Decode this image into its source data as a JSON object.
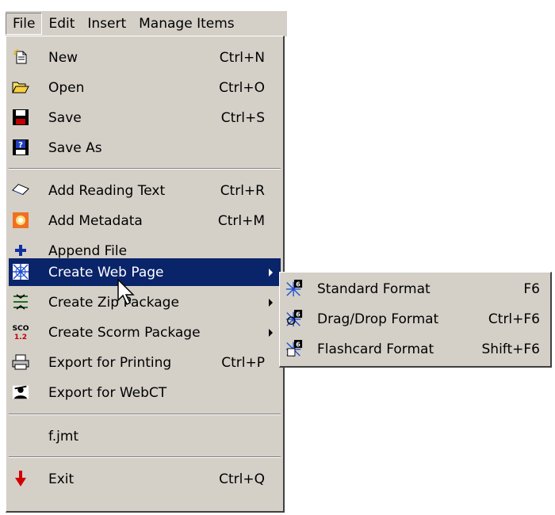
{
  "menubar": {
    "file": "File",
    "edit": "Edit",
    "insert": "Insert",
    "manage_items": "Manage Items"
  },
  "file_menu": {
    "new": {
      "label": "New",
      "shortcut": "Ctrl+N",
      "icon": "new-document-icon"
    },
    "open": {
      "label": "Open",
      "shortcut": "Ctrl+O",
      "icon": "folder-open-icon"
    },
    "save": {
      "label": "Save",
      "shortcut": "Ctrl+S",
      "icon": "floppy-disk-icon"
    },
    "save_as": {
      "label": "Save As",
      "icon": "save-as-icon"
    },
    "add_reading_text": {
      "label": "Add Reading Text",
      "shortcut": "Ctrl+R",
      "icon": "book-icon"
    },
    "add_metadata": {
      "label": "Add Metadata",
      "shortcut": "Ctrl+M",
      "icon": "metadata-icon"
    },
    "append_file": {
      "label": "Append File",
      "icon": "plus-icon"
    },
    "create_web_page": {
      "label": "Create Web Page",
      "icon": "web-page-icon"
    },
    "create_zip_package": {
      "label": "Create Zip Package",
      "icon": "zip-icon"
    },
    "create_scorm_package": {
      "label": "Create Scorm Package",
      "icon": "scorm-icon",
      "icon_text_top": "SCO",
      "icon_text_bottom": "1.2"
    },
    "export_for_printing": {
      "label": "Export for Printing",
      "shortcut": "Ctrl+P",
      "icon": "printer-icon"
    },
    "export_for_webct": {
      "label": "Export for WebCT",
      "icon": "webct-icon"
    },
    "recent_file": {
      "label": "f.jmt"
    },
    "exit": {
      "label": "Exit",
      "shortcut": "Ctrl+Q",
      "icon": "exit-arrow-icon"
    }
  },
  "web_page_submenu": {
    "standard_format": {
      "label": "Standard Format",
      "shortcut": "F6",
      "icon": "hot-potatoes-6-icon"
    },
    "drag_drop_format": {
      "label": "Drag/Drop Format",
      "shortcut": "Ctrl+F6",
      "icon": "hot-potatoes-6-drag-icon"
    },
    "flashcard_format": {
      "label": "Flashcard Format",
      "shortcut": "Shift+F6",
      "icon": "hot-potatoes-6-flashcard-icon"
    }
  },
  "colors": {
    "menu_bg": "#d4d0c8",
    "highlight": "#0a246a"
  }
}
